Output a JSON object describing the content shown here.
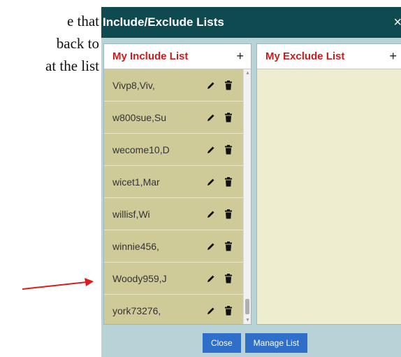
{
  "background_text": {
    "lines": [
      "e that",
      "back to",
      "at the list"
    ]
  },
  "dialog": {
    "title": "Include/Exclude Lists",
    "close_symbol": "×"
  },
  "include_panel": {
    "title": "My Include List",
    "add_symbol": "+",
    "items": [
      {
        "label": "Vivp8,Viv,"
      },
      {
        "label": "w800sue,Su"
      },
      {
        "label": "wecome10,D"
      },
      {
        "label": "wicet1,Mar"
      },
      {
        "label": "willisf,Wi"
      },
      {
        "label": "winnie456,"
      },
      {
        "label": "Woody959,J"
      },
      {
        "label": "york73276,"
      }
    ]
  },
  "exclude_panel": {
    "title": "My Exclude List",
    "add_symbol": "+",
    "items": []
  },
  "footer": {
    "close_label": "Close",
    "manage_label": "Manage List"
  },
  "icons": {
    "edit": "pencil-icon",
    "delete": "trash-icon"
  },
  "colors": {
    "titlebar": "#0e4a4f",
    "panel_title": "#d11a1a",
    "button": "#2f6fc9",
    "annotation_arrow": "#e01b1b"
  }
}
